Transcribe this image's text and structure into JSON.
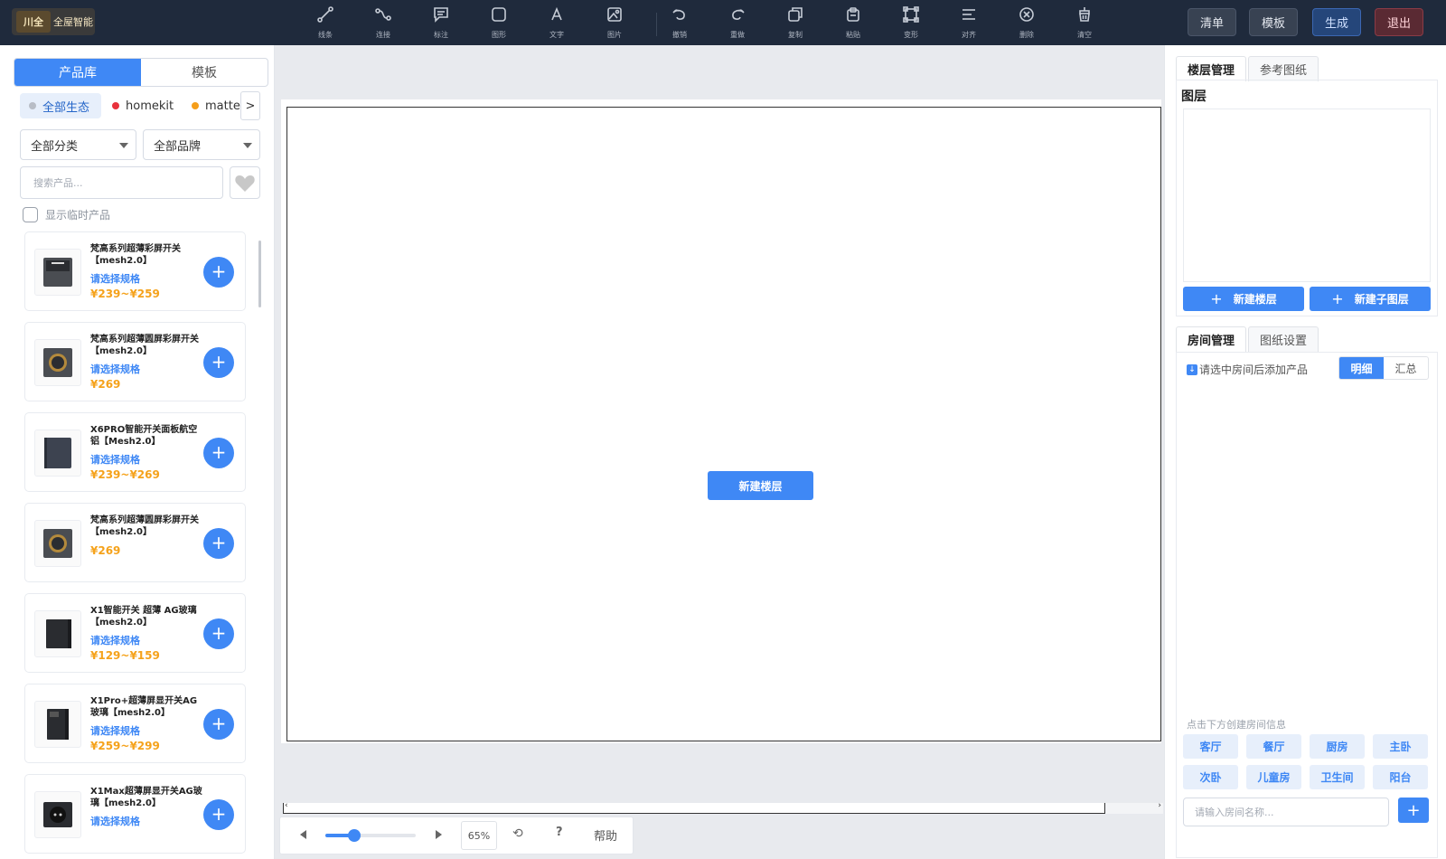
{
  "header": {
    "logo_mark": "川全",
    "logo_text": "全屋智能",
    "tools": [
      {
        "label": "线条",
        "icon": "line-icon"
      },
      {
        "label": "连接",
        "icon": "connect-icon"
      },
      {
        "label": "标注",
        "icon": "annotate-icon"
      },
      {
        "label": "图形",
        "icon": "shape-icon"
      },
      {
        "label": "文字",
        "icon": "text-icon"
      },
      {
        "label": "图片",
        "icon": "image-icon"
      },
      {
        "label": "撤销",
        "icon": "undo-icon"
      },
      {
        "label": "重做",
        "icon": "redo-icon"
      },
      {
        "label": "复制",
        "icon": "copy-icon"
      },
      {
        "label": "粘贴",
        "icon": "paste-icon"
      },
      {
        "label": "变形",
        "icon": "transform-icon"
      },
      {
        "label": "对齐",
        "icon": "align-icon"
      },
      {
        "label": "删除",
        "icon": "delete-icon"
      },
      {
        "label": "清空",
        "icon": "clear-icon"
      }
    ],
    "btn_list": "清单",
    "btn_template": "模板",
    "btn_generate": "生成",
    "btn_exit": "退出"
  },
  "left": {
    "tab_products": "产品库",
    "tab_templates": "模板",
    "ecosystems": [
      {
        "label": "全部生态",
        "color": "#b8bdc6"
      },
      {
        "label": "homekit",
        "color": "#e8323c"
      },
      {
        "label": "matter",
        "color": "#f59e1b"
      }
    ],
    "eco_next": ">",
    "category": "全部分类",
    "brand": "全部品牌",
    "search_placeholder": "搜索产品...",
    "show_temp": "显示临时产品",
    "products": [
      {
        "name": "梵高系列超薄彩屏开关【mesh2.0】",
        "spec": "请选择规格",
        "price": "¥239~¥259",
        "thumb": "square-dark"
      },
      {
        "name": "梵高系列超薄圆屏彩屏开关【mesh2.0】",
        "spec": "请选择规格",
        "price": "¥269",
        "thumb": "round-gold"
      },
      {
        "name": "X6PRO智能开关面板航空铝【Mesh2.0】",
        "spec": "请选择规格",
        "price": "¥239~¥269",
        "thumb": "panel-slate"
      },
      {
        "name": "梵高系列超薄圆屏彩屏开关【mesh2.0】",
        "spec": "",
        "price": "¥269",
        "thumb": "round-gold"
      },
      {
        "name": "X1智能开关 超薄 AG玻璃【mesh2.0】",
        "spec": "请选择规格",
        "price": "¥129~¥159",
        "thumb": "panel-black"
      },
      {
        "name": "X1Pro+超薄屏显开关AG玻璃【mesh2.0】",
        "spec": "请选择规格",
        "price": "¥259~¥299",
        "thumb": "panel-black-screen"
      },
      {
        "name": "X1Max超薄屏显开关AG玻璃【mesh2.0】",
        "spec": "请选择规格",
        "price": "",
        "thumb": "panel-black-round"
      }
    ]
  },
  "canvas": {
    "new_floor": "新建楼层",
    "zoom_pct": "65%",
    "zoom_level": 0.32,
    "help": "帮助",
    "question": "?"
  },
  "right": {
    "tab_floor": "楼层管理",
    "tab_ref": "参考图纸",
    "layers_title": "图层",
    "btn_new_floor": "新建楼层",
    "btn_new_sublayer": "新建子图层",
    "tab_room": "房间管理",
    "tab_drawing": "图纸设置",
    "room_hint": "请选中房间后添加产品",
    "seg_detail": "明细",
    "seg_summary": "汇总",
    "create_hint": "点击下方创建房间信息",
    "rooms": [
      "客厅",
      "餐厅",
      "厨房",
      "主卧",
      "次卧",
      "儿童房",
      "卫生间",
      "阳台"
    ],
    "room_input_placeholder": "请输入房间名称..."
  }
}
